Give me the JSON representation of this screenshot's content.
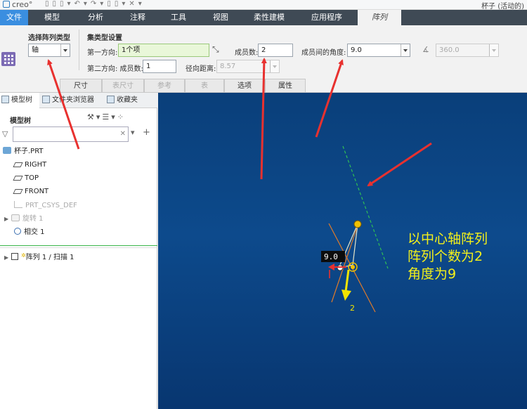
{
  "app": {
    "logo": "creo°",
    "window_title": "杯子 (活动的)"
  },
  "ribbon_tabs": [
    {
      "label": "文件"
    },
    {
      "label": "模型"
    },
    {
      "label": "分析"
    },
    {
      "label": "注释"
    },
    {
      "label": "工具"
    },
    {
      "label": "视图"
    },
    {
      "label": "柔性建模"
    },
    {
      "label": "应用程序"
    },
    {
      "label": "阵列"
    }
  ],
  "ribbon": {
    "type_group_title": "选择阵列类型",
    "pattern_type": "轴",
    "set_group_title": "集类型设置",
    "first_direction_label": "第一方向:",
    "first_direction_value": "1个项",
    "members_label": "成员数:",
    "members_value": "2",
    "angle_label": "成员间的角度:",
    "angle_value": "9.0",
    "total_angle_value": "360.0",
    "second_direction_label": "第二方向: 成员数:",
    "second_members_value": "1",
    "radial_label": "径向距离:",
    "radial_value": "8.57",
    "sub_tabs": [
      {
        "label": "尺寸"
      },
      {
        "label": "表尺寸"
      },
      {
        "label": "参考"
      },
      {
        "label": "表"
      },
      {
        "label": "选项"
      },
      {
        "label": "属性"
      }
    ]
  },
  "panel": {
    "tabs": [
      {
        "label": "模型树"
      },
      {
        "label": "文件夹浏览器"
      },
      {
        "label": "收藏夹"
      }
    ],
    "title": "模型树",
    "search_placeholder": "",
    "tree": [
      {
        "label": "杯子.PRT"
      },
      {
        "label": "RIGHT"
      },
      {
        "label": "TOP"
      },
      {
        "label": "FRONT"
      },
      {
        "label": "PRT_CSYS_DEF"
      },
      {
        "label": "旋转 1"
      },
      {
        "label": "相交 1"
      },
      {
        "label": "阵列 1 / 扫描 1"
      }
    ]
  },
  "graphics": {
    "angle_tag": "9.0",
    "count_tag": "2",
    "annotation": [
      "以中心轴阵列",
      "阵列个数为2",
      "角度为9"
    ]
  },
  "colors": {
    "tab_bar": "#3f4a55",
    "file_tab": "#3a8ee0",
    "viewport_top": "#0a3f7a",
    "arrow_red": "#e8312f",
    "annotation_yellow": "#f4f01a"
  }
}
